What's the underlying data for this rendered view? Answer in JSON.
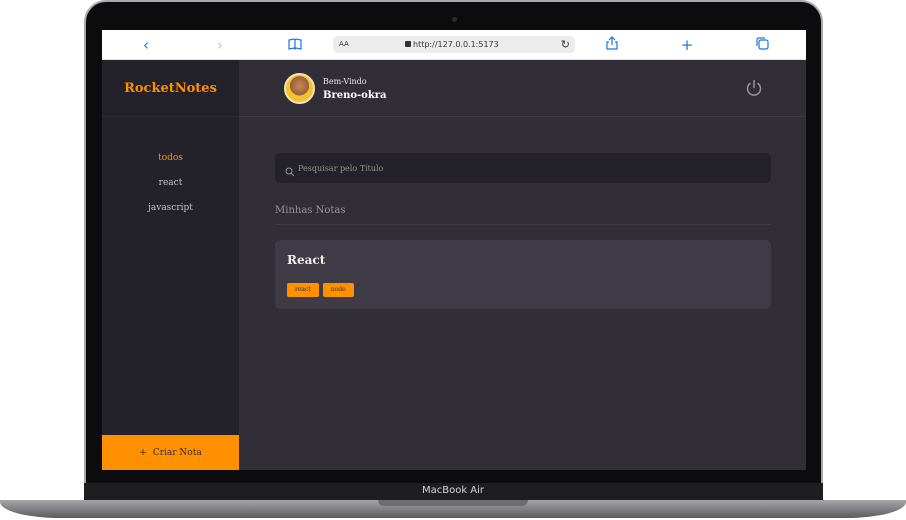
{
  "device": {
    "label": "MacBook Air"
  },
  "browser": {
    "text_size_label": "AA",
    "url": "http://127.0.0.1:5173",
    "icons": [
      "back-icon",
      "forward-icon",
      "bookmarks-icon",
      "lock-icon",
      "reload-icon",
      "share-icon",
      "new-tab-icon",
      "tabs-icon"
    ]
  },
  "app": {
    "brand": "RocketNotes",
    "tags": [
      {
        "label": "todos",
        "active": true
      },
      {
        "label": "react",
        "active": false
      },
      {
        "label": "javascript",
        "active": false
      }
    ],
    "new_note": {
      "icon": "+",
      "label": "Criar Nota"
    },
    "header": {
      "welcome": "Bem-Vindo",
      "username": "Breno-okra"
    },
    "search": {
      "placeholder": "Pesquisar pelo Título",
      "value": ""
    },
    "section_title": "Minhas Notas",
    "notes": [
      {
        "title": "React",
        "tags": [
          "react",
          "node"
        ]
      }
    ],
    "colors": {
      "accent": "#ff9000",
      "background": "#312e38",
      "sidebar": "#232129",
      "card": "#3e3b47"
    }
  }
}
